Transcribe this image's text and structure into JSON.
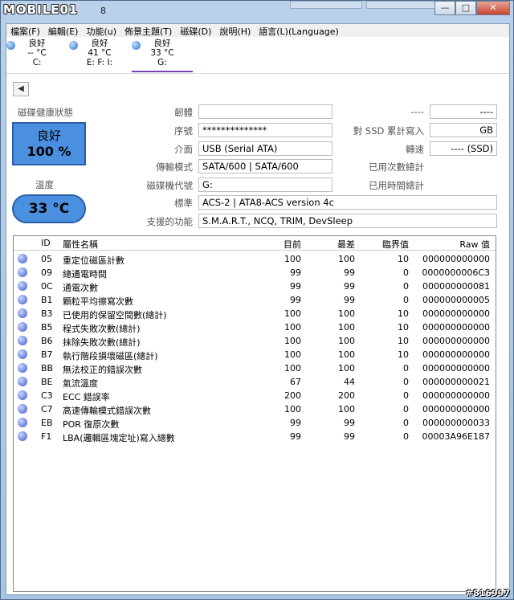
{
  "title": {
    "logo": "MOBILE01",
    "suffix": "8"
  },
  "window_buttons": [
    "—",
    "□",
    "✕"
  ],
  "menu": [
    "檔案(F)",
    "編輯(E)",
    "功能(u)",
    "佈景主題(T)",
    "磁碟(D)",
    "說明(H)",
    "語言(L)(Language)"
  ],
  "drives": [
    {
      "status": "良好",
      "temp": "-- °C",
      "letter": "C:"
    },
    {
      "status": "良好",
      "temp": "41 °C",
      "letter": "E: F: I:"
    },
    {
      "status": "良好",
      "temp": "33 °C",
      "letter": "G:"
    }
  ],
  "back_icon": "◀",
  "info": {
    "health_label": "磁碟健康狀態",
    "health_status": "良好",
    "health_percent": "100 %",
    "temp_label": "溫度",
    "temp_value": "33 °C",
    "firmware_label": "韌體",
    "firmware_value": "",
    "serial_label": "序號",
    "serial_value": "**************",
    "interface_label": "介面",
    "interface_value": "USB (Serial ATA)",
    "transfer_label": "傳輸模式",
    "transfer_value": "SATA/600 | SATA/600",
    "drive_letter_label": "磁碟機代號",
    "drive_letter_value": "G:",
    "standard_label": "標準",
    "standard_value": "ACS-2 | ATA8-ACS version 4c",
    "features_label": "支援的功能",
    "features_value": "S.M.A.R.T., NCQ, TRIM, DevSleep",
    "top_right_label": "----",
    "top_right_value": "----",
    "ssd_writes_label": "對 SSD 累計寫入",
    "ssd_writes_value": "GB",
    "rotation_label": "轉速",
    "rotation_value": "---- (SSD)",
    "power_count_label": "已用次數總計",
    "power_hours_label": "已用時間總計"
  },
  "table": {
    "headers": {
      "id": "ID",
      "name": "屬性名稱",
      "current": "目前",
      "worst": "最差",
      "threshold": "臨界值",
      "raw": "Raw 值"
    },
    "rows": [
      {
        "id": "05",
        "name": "重定位磁區計數",
        "current": "100",
        "worst": "100",
        "threshold": "10",
        "raw": "000000000000"
      },
      {
        "id": "09",
        "name": "總通電時間",
        "current": "99",
        "worst": "99",
        "threshold": "0",
        "raw": "0000000006C3"
      },
      {
        "id": "0C",
        "name": "通電次數",
        "current": "99",
        "worst": "99",
        "threshold": "0",
        "raw": "000000000081"
      },
      {
        "id": "B1",
        "name": "顆粒平均擦寫次數",
        "current": "99",
        "worst": "99",
        "threshold": "0",
        "raw": "000000000005"
      },
      {
        "id": "B3",
        "name": "已使用的保留空間數(總計)",
        "current": "100",
        "worst": "100",
        "threshold": "10",
        "raw": "000000000000"
      },
      {
        "id": "B5",
        "name": "程式失敗次數(總計)",
        "current": "100",
        "worst": "100",
        "threshold": "10",
        "raw": "000000000000"
      },
      {
        "id": "B6",
        "name": "抹除失敗次數(總計)",
        "current": "100",
        "worst": "100",
        "threshold": "10",
        "raw": "000000000000"
      },
      {
        "id": "B7",
        "name": "執行階段損壞磁區(總計)",
        "current": "100",
        "worst": "100",
        "threshold": "10",
        "raw": "000000000000"
      },
      {
        "id": "BB",
        "name": "無法校正的錯誤次數",
        "current": "100",
        "worst": "100",
        "threshold": "0",
        "raw": "000000000000"
      },
      {
        "id": "BE",
        "name": "氣流溫度",
        "current": "67",
        "worst": "44",
        "threshold": "0",
        "raw": "000000000021"
      },
      {
        "id": "C3",
        "name": "ECC 錯誤率",
        "current": "200",
        "worst": "200",
        "threshold": "0",
        "raw": "000000000000"
      },
      {
        "id": "C7",
        "name": "高速傳輸模式錯誤次數",
        "current": "100",
        "worst": "100",
        "threshold": "0",
        "raw": "000000000000"
      },
      {
        "id": "EB",
        "name": "POR 復原次數",
        "current": "99",
        "worst": "99",
        "threshold": "0",
        "raw": "000000000033"
      },
      {
        "id": "F1",
        "name": "LBA(邏輯區塊定址)寫入總數",
        "current": "99",
        "worst": "99",
        "threshold": "0",
        "raw": "00003A96E187"
      }
    ]
  },
  "watermark": "#816997"
}
